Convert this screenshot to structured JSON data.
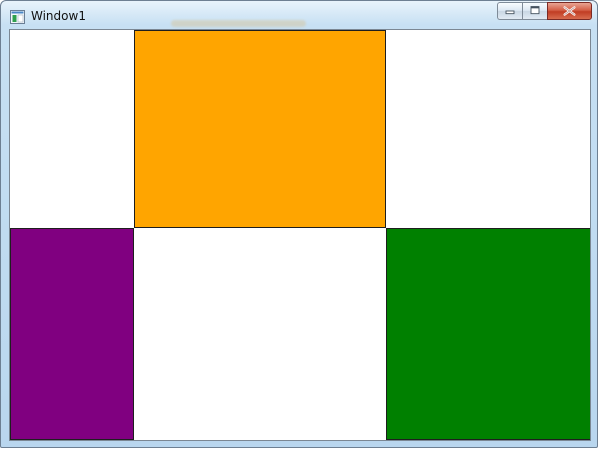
{
  "window": {
    "title": "Window1"
  },
  "titlebar": {
    "icon": "window-app-icon",
    "buttons": {
      "minimize": "minimize-icon",
      "maximize": "maximize-icon",
      "close": "close-icon"
    }
  },
  "panels": {
    "orange": {
      "color": "#ffa500"
    },
    "purple": {
      "color": "#800080"
    },
    "green": {
      "color": "#008000"
    }
  }
}
